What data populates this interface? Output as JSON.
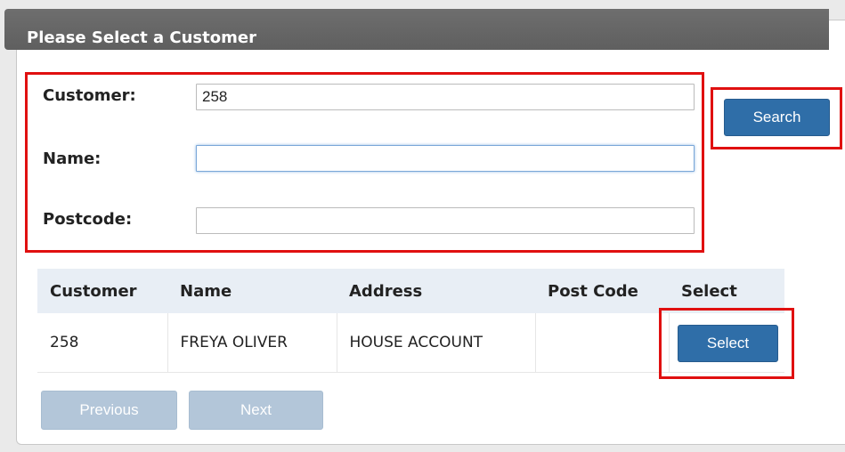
{
  "panel": {
    "title": "Please Select a Customer"
  },
  "form": {
    "customer_label": "Customer:",
    "customer_value": "258",
    "name_label": "Name:",
    "name_value": "",
    "postcode_label": "Postcode:",
    "postcode_value": "",
    "search_label": "Search"
  },
  "table": {
    "headers": [
      "Customer",
      "Name",
      "Address",
      "Post Code",
      "Select"
    ],
    "rows": [
      {
        "customer": "258",
        "name": "FREYA OLIVER",
        "address": "HOUSE ACCOUNT",
        "post_code": "",
        "select_label": "Select"
      }
    ]
  },
  "pagination": {
    "previous_label": "Previous",
    "next_label": "Next"
  },
  "colors": {
    "header_bar": "#666666",
    "primary_button": "#2f6ea8",
    "disabled_button": "#b3c6d9",
    "highlight_box": "#e01010",
    "table_header_bg": "#e8eef5"
  }
}
